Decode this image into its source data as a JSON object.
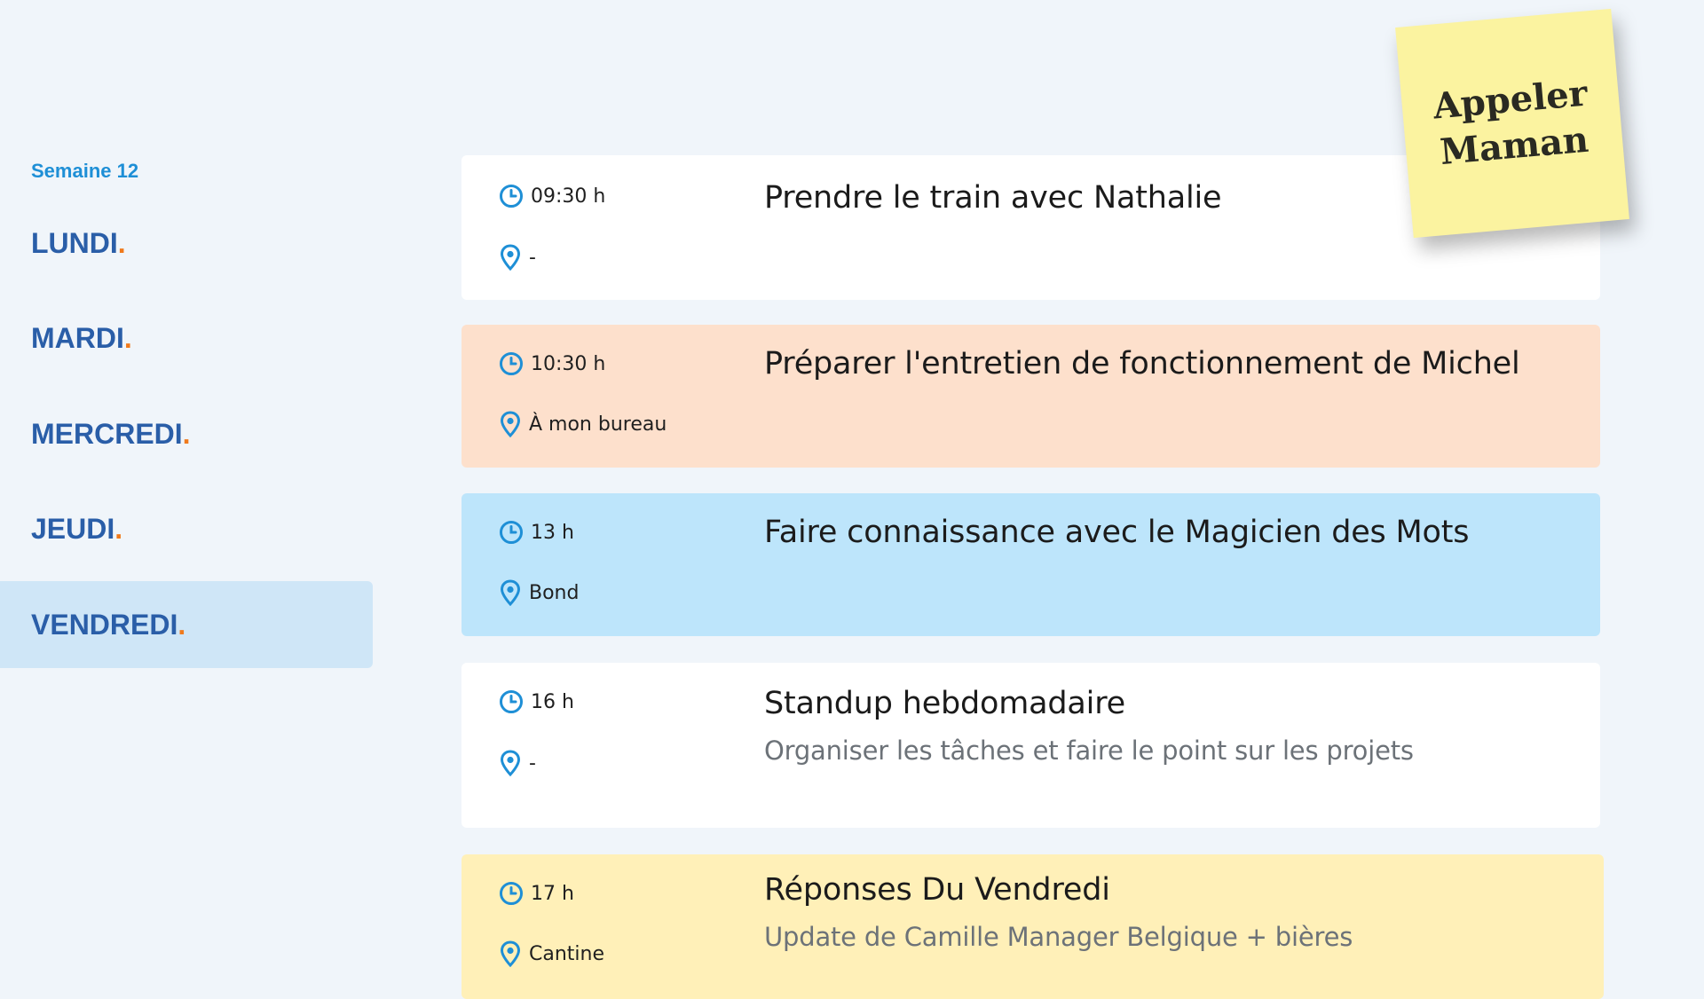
{
  "sidebar": {
    "week_label": "Semaine 12",
    "days": [
      {
        "label": "LUNDI",
        "dot": "."
      },
      {
        "label": "MARDI",
        "dot": "."
      },
      {
        "label": "MERCREDI",
        "dot": "."
      },
      {
        "label": "JEUDI",
        "dot": "."
      },
      {
        "label": "VENDREDI",
        "dot": ".",
        "active": true
      }
    ]
  },
  "events": [
    {
      "time": "09:30 h",
      "location": "-",
      "title": "Prendre le train avec Nathalie",
      "description": "",
      "color": "#ffffff"
    },
    {
      "time": "10:30 h",
      "location": "À mon bureau",
      "title": "Préparer l'entretien de fonctionnement de Michel",
      "description": "",
      "color": "#fde0cc"
    },
    {
      "time": "13 h",
      "location": "Bond",
      "title": "Faire connaissance avec le Magicien des Mots",
      "description": "",
      "color": "#bde5fb"
    },
    {
      "time": "16 h",
      "location": "-",
      "title": "Standup hebdomadaire",
      "description": "Organiser les tâches et faire le point sur les projets",
      "color": "#ffffff"
    },
    {
      "time": "17 h",
      "location": "Cantine",
      "title": "Réponses Du Vendredi",
      "description": "Update de Camille Manager Belgique + bières",
      "color": "#fff0b8"
    }
  ],
  "sticky_note": {
    "line1": "Appeler",
    "line2": "Maman",
    "color": "#fbf3a0"
  },
  "icons": {
    "time": "clock-icon",
    "location": "map-pin-icon"
  },
  "colors": {
    "accent_blue": "#1e8fd6",
    "day_text": "#2a5ea8",
    "dot_orange": "#f07a1c",
    "active_day_bg": "#cfe6f7"
  }
}
